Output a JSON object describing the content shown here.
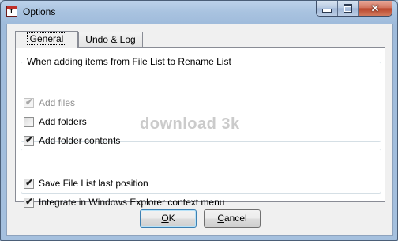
{
  "window": {
    "title": "Options",
    "app_icon_glyph": "I",
    "caption_buttons": {
      "minimize": "minimize-icon",
      "maximize": "maximize-icon",
      "close": "close-icon",
      "close_glyph": "✕"
    }
  },
  "tabs": [
    {
      "label": "General",
      "active": true
    },
    {
      "label": "Undo & Log",
      "active": false
    }
  ],
  "group1": {
    "title": "When adding items from File List to Rename List",
    "items": [
      {
        "label": "Add files",
        "checked": true,
        "enabled": false
      },
      {
        "label": "Add folders",
        "checked": false,
        "enabled": true
      },
      {
        "label": "Add folder contents",
        "checked": true,
        "enabled": true
      }
    ]
  },
  "group2": {
    "items": [
      {
        "label": "Save File List last position",
        "checked": true,
        "enabled": true
      },
      {
        "label": "Integrate in Windows Explorer context menu",
        "checked": true,
        "enabled": true
      }
    ]
  },
  "watermark": "download 3k",
  "buttons": {
    "ok": {
      "mnemonic": "O",
      "rest": "K"
    },
    "cancel": {
      "mnemonic": "C",
      "rest": "ancel"
    }
  },
  "check_glyph": "✔",
  "colors": {
    "titlebar": "#a9c3e0",
    "close_button": "#c7553a",
    "default_button_border": "#3c7fb1"
  }
}
